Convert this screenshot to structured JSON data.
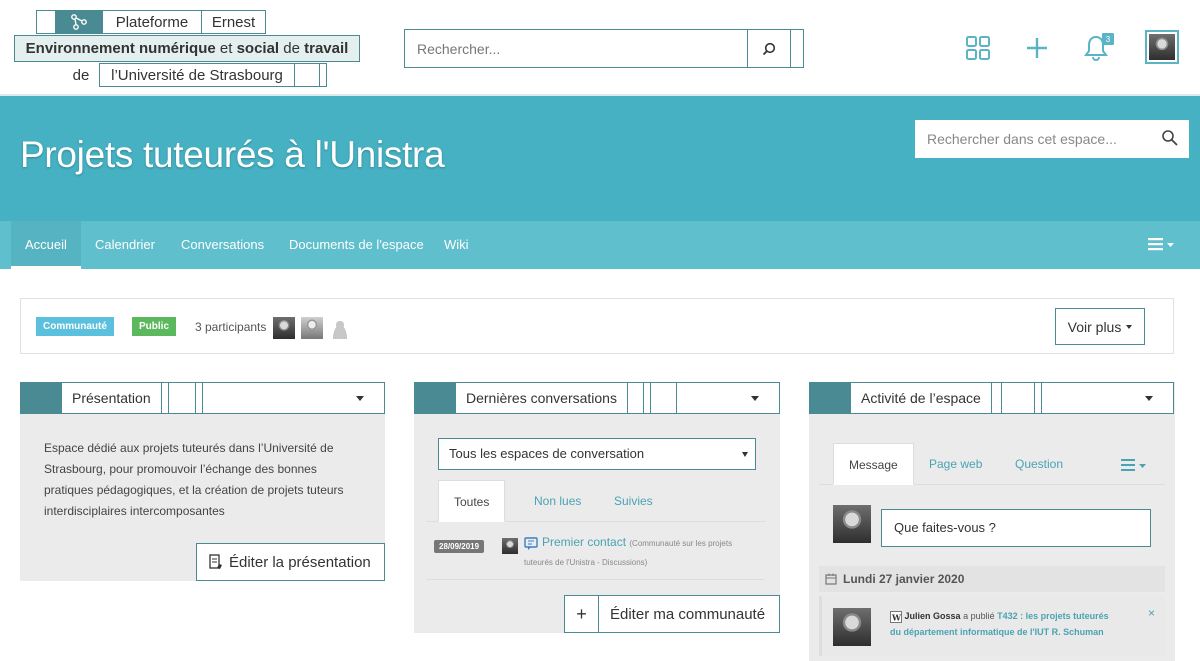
{
  "logo": {
    "line1_a": "Plateforme",
    "line1_b": "Ernest",
    "line2_b1": "Environnement numérique",
    "line2_t1": "et",
    "line2_b2": "social",
    "line2_t2": "de",
    "line2_b3": "travail",
    "line3_a": "de",
    "line3_b": "l’Université de Strasbourg"
  },
  "header": {
    "search_placeholder": "Rechercher...",
    "notifications_count": "3"
  },
  "space": {
    "title": "Projets tuteurés à l'Unistra",
    "search_placeholder": "Rechercher dans cet espace..."
  },
  "tabs": [
    {
      "label": "Accueil"
    },
    {
      "label": "Calendrier"
    },
    {
      "label": "Conversations"
    },
    {
      "label": "Documents de l'espace"
    },
    {
      "label": "Wiki"
    }
  ],
  "info": {
    "badge_community": "Communauté",
    "badge_public": "Public",
    "participants": "3 participants",
    "voir_plus": "Voir plus"
  },
  "presentation": {
    "title": "Présentation",
    "text": "Espace dédié aux projets tuteurés dans l’Université de Strasbourg, pour promouvoir l’échange des bonnes pratiques pédagogiques, et la création de projets tuteurs interdisciplaires intercomposantes",
    "edit_button": "Éditer la présentation"
  },
  "conversations": {
    "title": "Dernières conversations",
    "select_value": "Tous les espaces de conversation",
    "subtabs": [
      "Toutes",
      "Non lues",
      "Suivies"
    ],
    "item_date": "28/09/2019",
    "item_title": "Premier contact",
    "item_meta_1": "(Communauté sur les projets",
    "item_meta_2": "tuteurés de l'Unistra - Discussions)",
    "edit_button": "Éditer ma communauté"
  },
  "activity": {
    "title": "Activité de l’espace",
    "subtabs": [
      "Message",
      "Page web",
      "Question"
    ],
    "message_placeholder": "Que faites-vous ?",
    "day": "Lundi 27 janvier 2020",
    "item_user": "Julien Gossa",
    "item_action": "a publié",
    "item_title_1": "T432 : les projets tuteurés",
    "item_title_2": "du département informatique de l'IUT R. Schuman",
    "close": "×"
  },
  "colors": {
    "accent": "#45b1c2",
    "tab_bar": "#5fbfcd",
    "border": "#4a8a92",
    "badge_community": "#5bc0de",
    "badge_public": "#5cb85c"
  }
}
